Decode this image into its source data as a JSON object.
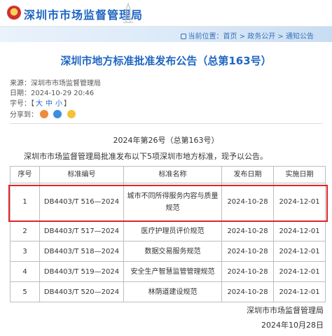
{
  "header": {
    "site_title": "深圳市市场监督管理局"
  },
  "breadcrumb": {
    "text": "当前位置：首页 > 政务公开 > 通知公告"
  },
  "article": {
    "title": "深圳市地方标准批准发布公告（总第163号）",
    "source_label": "来源：",
    "source": "深圳市市场监督管理局",
    "date_label": "日期：",
    "date": "2024-10-29 20:46",
    "font_size_label": "字号：",
    "font_sizes": [
      "大",
      "中",
      "小"
    ],
    "share_label": "分享到：",
    "doc_number": "2024年第26号（总第163号）",
    "intro": "深圳市市场监督管理局批准发布以下5项深圳市地方标准，现予以公告。"
  },
  "table": {
    "headers": [
      "序号",
      "标准编号",
      "标准名称",
      "发布日期",
      "实施日期"
    ],
    "rows": [
      [
        "1",
        "DB4403/T 516—2024",
        "城市不同所得服务内容与质量规范",
        "2024-10-28",
        "2024-12-01"
      ],
      [
        "2",
        "DB4403/T 517—2024",
        "医疗护理员评价规范",
        "2024-10-28",
        "2024-12-01"
      ],
      [
        "3",
        "DB4403/T 518—2024",
        "数据交易服务规范",
        "2024-10-28",
        "2024-12-01"
      ],
      [
        "4",
        "DB4403/T 519—2024",
        "安全生产智慧监管管理规范",
        "2024-10-28",
        "2024-12-01"
      ],
      [
        "5",
        "DB4403/T 520—2024",
        "林荫道建设规范",
        "2024-10-28",
        "2024-12-01"
      ]
    ]
  },
  "signature": {
    "org": "深圳市市场监督管理局",
    "date": "2024年10月28日"
  },
  "colors": {
    "brand_blue": "#1f66c2",
    "highlight_red": "#e0252b"
  },
  "icons": {
    "share": [
      "weibo-icon",
      "wechat-icon",
      "qq-icon"
    ]
  }
}
